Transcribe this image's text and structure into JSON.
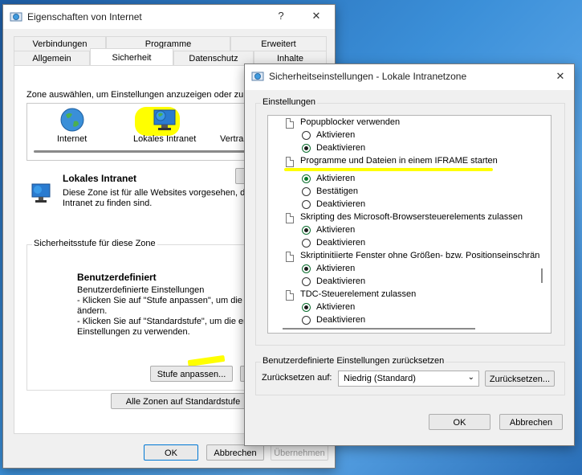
{
  "colors": {
    "accent": "#0078d4",
    "highlight": "#ffff00"
  },
  "main": {
    "title": "Eigenschaften von Internet",
    "help_label": "?",
    "close_label": "✕",
    "tabs_row1": [
      "Verbindungen",
      "Programme",
      "Erweitert"
    ],
    "tabs_row2": [
      "Allgemein",
      "Sicherheit",
      "Datenschutz",
      "Inhalte"
    ],
    "zone_prompt": "Zone auswählen, um Einstellungen anzuzeigen oder zu ä",
    "zones": [
      "Internet",
      "Lokales Intranet",
      "Vertra"
    ],
    "zone_title": "Lokales Intranet",
    "zone_desc": [
      "Diese Zone ist für alle Websites vorgesehen, di",
      "Intranet zu finden sind."
    ],
    "level_legend": "Sicherheitsstufe für diese Zone",
    "level_title": "Benutzerdefiniert",
    "level_desc": [
      "Benutzerdefinierte Einstellungen",
      "- Klicken Sie auf \"Stufe anpassen\", um die Ei",
      "ändern.",
      "- Klicken Sie auf \"Standardstufe\", um die em",
      "Einstellungen zu verwenden."
    ],
    "stufe_button": "Stufe anpassen...",
    "alle_zonen_button": "Alle Zonen auf Standardstufe",
    "ok": "OK",
    "cancel": "Abbrechen",
    "apply": "Übernehmen"
  },
  "dialog": {
    "title": "Sicherheitseinstellungen - Lokale Intranetzone",
    "close_label": "✕",
    "settings_legend": "Einstellungen",
    "settings": [
      {
        "label": "Popupblocker verwenden",
        "options": [
          "Aktivieren",
          "Deaktivieren"
        ],
        "selected": 1
      },
      {
        "label": "Programme und Dateien in einem IFRAME starten",
        "options": [
          "Aktivieren",
          "Bestätigen",
          "Deaktivieren"
        ],
        "selected": 0
      },
      {
        "label": "Skripting des Microsoft-Browsersteuerelements zulassen",
        "options": [
          "Aktivieren",
          "Deaktivieren"
        ],
        "selected": 0
      },
      {
        "label": "Skriptinitiierte Fenster ohne Größen- bzw. Positionseinschrän",
        "options": [
          "Aktivieren",
          "Deaktivieren"
        ],
        "selected": 0
      },
      {
        "label": "TDC-Steuerelement zulassen",
        "options": [
          "Aktivieren",
          "Deaktivieren"
        ],
        "selected": 0
      }
    ],
    "reset_legend": "Benutzerdefinierte Einstellungen zurücksetzen",
    "reset_label": "Zurücksetzen auf:",
    "reset_value": "Niedrig (Standard)",
    "reset_button": "Zurücksetzen...",
    "ok": "OK",
    "cancel": "Abbrechen"
  }
}
